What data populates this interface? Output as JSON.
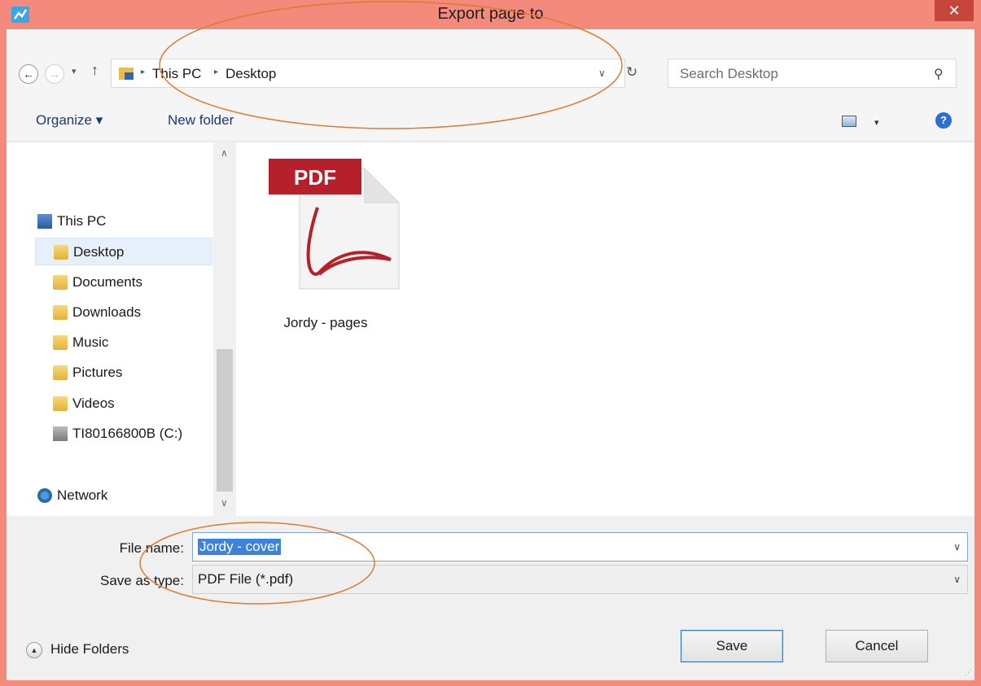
{
  "window": {
    "title": "Export page to",
    "close_glyph": "✕"
  },
  "nav": {
    "back_glyph": "←",
    "forward_glyph": "→",
    "recent_glyph": "▾",
    "up_glyph": "↑",
    "breadcrumb": [
      "This PC",
      "Desktop"
    ],
    "breadcrumb_sep": "▸",
    "address_dropdown_glyph": "∨",
    "refresh_glyph": "↻",
    "search_placeholder": "Search Desktop",
    "search_glyph": "⚲"
  },
  "toolbar": {
    "organize_label": "Organize ▾",
    "new_folder_label": "New folder",
    "view_dropdown_glyph": "▾",
    "help_glyph": "?"
  },
  "sidebar": {
    "items": [
      {
        "label": "This PC",
        "icon": "computer-icon"
      },
      {
        "label": "Desktop",
        "icon": "desktop-folder-icon",
        "selected": true
      },
      {
        "label": "Documents",
        "icon": "documents-folder-icon"
      },
      {
        "label": "Downloads",
        "icon": "downloads-folder-icon"
      },
      {
        "label": "Music",
        "icon": "music-folder-icon"
      },
      {
        "label": "Pictures",
        "icon": "pictures-folder-icon"
      },
      {
        "label": "Videos",
        "icon": "videos-folder-icon"
      },
      {
        "label": "TI80166800B (C:)",
        "icon": "drive-icon"
      },
      {
        "label": "Network",
        "icon": "network-icon"
      }
    ],
    "scroll_up_glyph": "∧",
    "scroll_down_glyph": "∨"
  },
  "files": [
    {
      "name": "Jordy - pages",
      "badge": "PDF",
      "icon": "pdf-file-icon"
    }
  ],
  "form": {
    "file_name_label": "File name:",
    "file_name_value": "Jordy - cover",
    "save_type_label": "Save as type:",
    "save_type_value": "PDF File (*.pdf)",
    "dropdown_glyph": "∨"
  },
  "footer": {
    "hide_folders_label": "Hide Folders",
    "hide_glyph": "▲",
    "save_label": "Save",
    "cancel_label": "Cancel"
  },
  "colors": {
    "titlebar": "#f38a7c",
    "close_button": "#c7463c",
    "selection": "#3a84df",
    "annotation": "#e07a2e",
    "pdf_red": "#b5202a"
  }
}
